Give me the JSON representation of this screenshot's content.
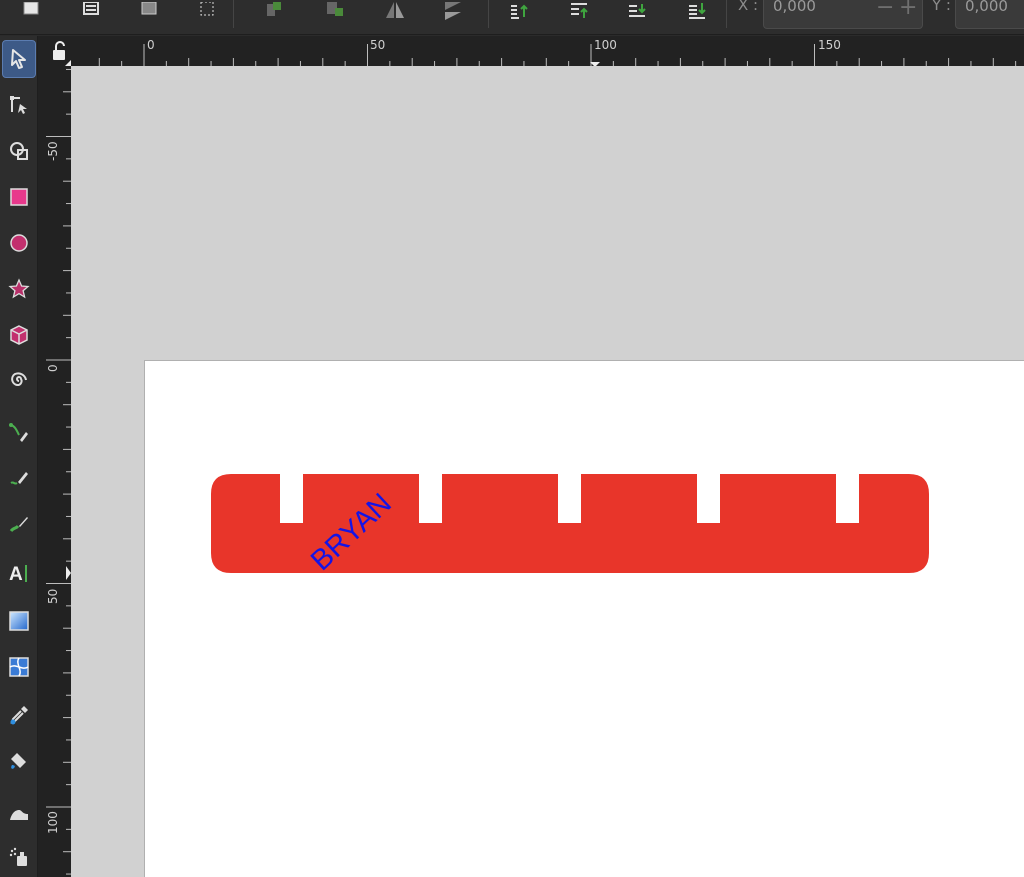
{
  "toolbar": {
    "x_label": "X :",
    "x_value": "0,000",
    "y_label": "Y :",
    "y_value": "0,000",
    "minus_label": "−",
    "plus_label": "+",
    "icons": [
      "select-all-icon",
      "select-all-layers-icon",
      "deselect-icon",
      "select-same-icon",
      "raise-to-top-icon",
      "lower-to-bottom-icon",
      "flip-horizontal-icon",
      "flip-vertical-icon",
      "raise-icon",
      "raise-step-icon",
      "lower-step-icon",
      "lower-to-bottom-align-icon"
    ]
  },
  "tools": [
    {
      "name": "selector-tool",
      "icon": "arrow-cursor-icon",
      "active": true
    },
    {
      "name": "node-tool",
      "icon": "node-edit-icon"
    },
    {
      "name": "shape-builder-tool",
      "icon": "shape-builder-icon"
    },
    {
      "name": "rectangle-tool",
      "icon": "rectangle-icon"
    },
    {
      "name": "ellipse-tool",
      "icon": "circle-icon"
    },
    {
      "name": "star-tool",
      "icon": "star-icon"
    },
    {
      "name": "box3d-tool",
      "icon": "cube-icon"
    },
    {
      "name": "spiral-tool",
      "icon": "spiral-icon"
    },
    {
      "name": "pen-tool",
      "icon": "pen-icon"
    },
    {
      "name": "pencil-tool",
      "icon": "pencil-icon"
    },
    {
      "name": "calligraphy-tool",
      "icon": "calligraphy-icon"
    },
    {
      "name": "text-tool",
      "icon": "text-icon"
    },
    {
      "name": "gradient-tool",
      "icon": "gradient-icon"
    },
    {
      "name": "mesh-tool",
      "icon": "mesh-icon"
    },
    {
      "name": "dropper-tool",
      "icon": "dropper-icon"
    },
    {
      "name": "paint-bucket-tool",
      "icon": "paint-bucket-icon"
    },
    {
      "name": "tweak-tool",
      "icon": "tweak-icon"
    },
    {
      "name": "spray-tool",
      "icon": "spray-icon"
    }
  ],
  "rulers": {
    "top_labels": [
      "0",
      "50",
      "100",
      "150"
    ],
    "left_labels": [
      "-50",
      "0",
      "50",
      "100"
    ]
  },
  "drawing": {
    "shape_color": "#e8352a",
    "text": "BRYAN",
    "text_color": "#1414e6"
  }
}
